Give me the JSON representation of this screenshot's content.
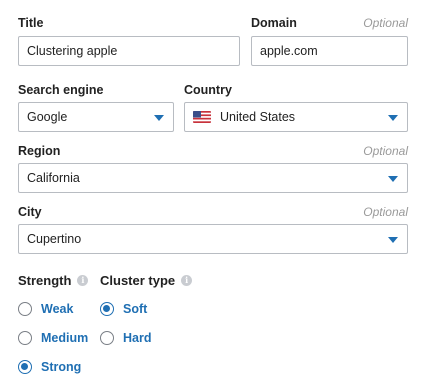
{
  "form": {
    "title": {
      "label": "Title",
      "value": "Clustering apple"
    },
    "domain": {
      "label": "Domain",
      "optional": "Optional",
      "value": "apple.com"
    },
    "search_engine": {
      "label": "Search engine",
      "value": "Google"
    },
    "country": {
      "label": "Country",
      "value": "United States",
      "flag_icon": "us-flag-icon"
    },
    "region": {
      "label": "Region",
      "optional": "Optional",
      "value": "California"
    },
    "city": {
      "label": "City",
      "optional": "Optional",
      "value": "Cupertino"
    }
  },
  "strength": {
    "label": "Strength",
    "options": [
      {
        "label": "Weak",
        "checked": false
      },
      {
        "label": "Medium",
        "checked": false
      },
      {
        "label": "Strong",
        "checked": true
      }
    ]
  },
  "cluster_type": {
    "label": "Cluster type",
    "options": [
      {
        "label": "Soft",
        "checked": true
      },
      {
        "label": "Hard",
        "checked": false
      }
    ]
  },
  "colors": {
    "accent": "#1f6fb3",
    "border": "#b8bcc2",
    "muted": "#9a9a9a"
  }
}
